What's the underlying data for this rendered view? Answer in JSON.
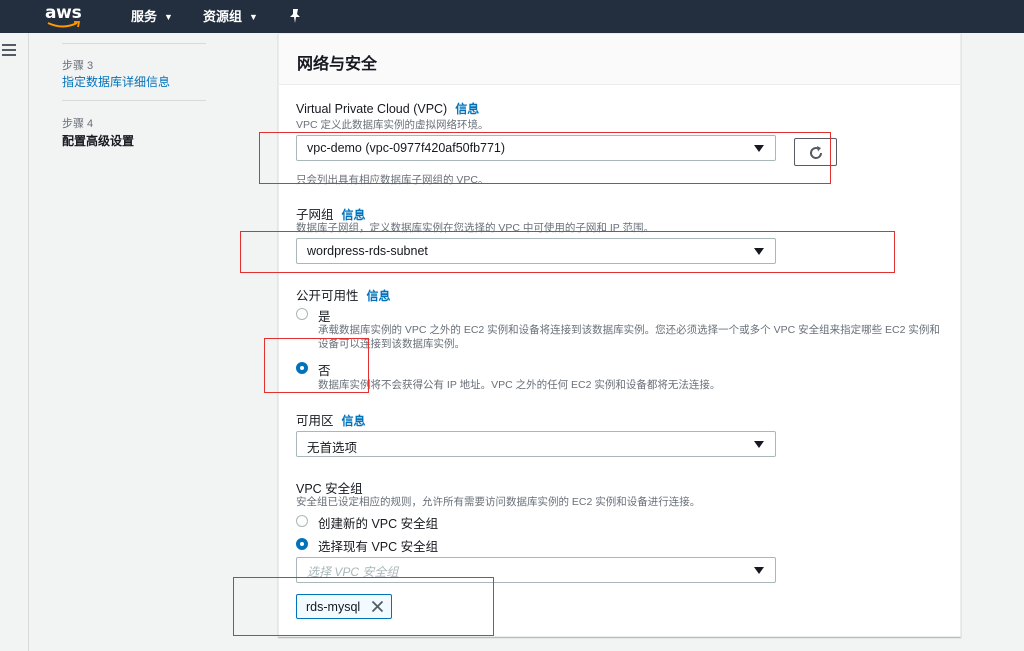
{
  "topnav": {
    "logo": "aws",
    "services_label": "服务",
    "resource_groups_label": "资源组"
  },
  "sidebar": {
    "steps": [
      {
        "number": "步骤 3",
        "label": "指定数据库详细信息"
      },
      {
        "number": "步骤 4",
        "label": "配置高级设置"
      }
    ]
  },
  "panel": {
    "title": "网络与安全",
    "info_label": "信息",
    "vpc": {
      "label": "Virtual Private Cloud (VPC)",
      "desc": "VPC 定义此数据库实例的虚拟网络环境。",
      "value": "vpc-demo (vpc-0977f420af50fb771)",
      "hint": "只会列出具有相应数据库子网组的 VPC。"
    },
    "subnet": {
      "label": "子网组",
      "desc": "数据库子网组，定义数据库实例在您选择的 VPC 中可使用的子网和 IP 范围。",
      "value": "wordpress-rds-subnet"
    },
    "public": {
      "label": "公开可用性",
      "yes_label": "是",
      "yes_desc": "承载数据库实例的 VPC 之外的 EC2 实例和设备将连接到该数据库实例。您还必须选择一个或多个 VPC 安全组来指定哪些 EC2 实例和设备可以连接到该数据库实例。",
      "no_label": "否",
      "no_desc": "数据库实例将不会获得公有 IP 地址。VPC 之外的任何 EC2 实例和设备都将无法连接。"
    },
    "az": {
      "label": "可用区",
      "value": "无首选项"
    },
    "sg": {
      "label": "VPC 安全组",
      "desc": "安全组已设定相应的规则，允许所有需要访问数据库实例的 EC2 实例和设备进行连接。",
      "create_label": "创建新的 VPC 安全组",
      "existing_label": "选择现有 VPC 安全组",
      "placeholder": "选择 VPC 安全组",
      "selected_token": "rds-mysql"
    }
  },
  "colors": {
    "nav_bg": "#232f3e",
    "link": "#0073bb",
    "highlight_box": "#e03030"
  }
}
